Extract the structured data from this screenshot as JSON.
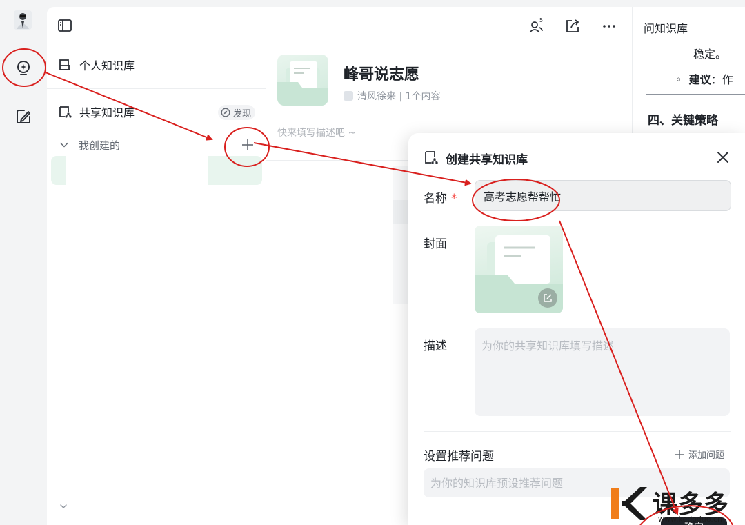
{
  "sidebar": {
    "personal_kb": "个人知识库",
    "shared_kb": "共享知识库",
    "discover": "发现",
    "my_created": "我创建的"
  },
  "main": {
    "kb_title": "峰哥说志愿",
    "kb_meta": "清风徐来 | 1个内容",
    "kb_desc_placeholder": "快来填写描述吧 ~",
    "member_count": "5"
  },
  "doc_panel": {
    "title": "问知识库",
    "line1": "稳定。",
    "bullet_bold": "建议",
    "bullet_rest": "：作",
    "heading": "四、关键策略"
  },
  "modal": {
    "title": "创建共享知识库",
    "name_label": "名称",
    "required_mark": "*",
    "name_value": "高考志愿帮帮忙",
    "cover_label": "封面",
    "desc_label": "描述",
    "desc_placeholder": "为你的共享知识库填写描述",
    "questions_label": "设置推荐问题",
    "add_question": "添加问题",
    "question_placeholder": "为你的知识库预设推荐问题",
    "confirm": "确定"
  },
  "watermark": {
    "text": "课多多",
    "url": "www.kedoduo.cn"
  },
  "colors": {
    "annotation_red": "#d9201e",
    "selected_item_bg": "#e8f5ee",
    "cover_green": "#cfe9db"
  }
}
